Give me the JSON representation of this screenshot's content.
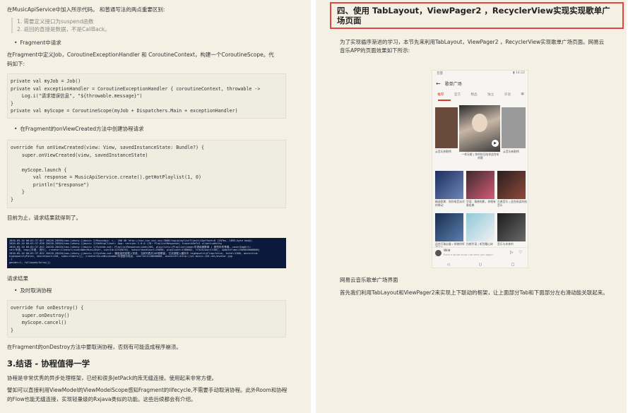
{
  "left": {
    "intro": "在MusicApiService中加入所示代码。 和普通写法的两点重要区别:",
    "quote1": "1. 需要定义接口为suspend函数",
    "quote2": "2. 返回的直接是数据，不是CallBack。",
    "bullet1": "Fragment中请求",
    "desc1a": "在Fragment中定义Job，CoroutineExceptionHandler 和 CoroutineContext，构建一个CoroutineScope。代",
    "desc1b": "码如下:",
    "code1": "private val myJob = Job()\nprivate val exceptionHandler = CoroutineExceptionHandler { coroutineContext, throwable ->\n    Log.i(\"请求错误信息\", \"${throwable.message}\")\n}\nprivate val myScope = CoroutineScope(myJob + Dispatchers.Main + exceptionHandler)",
    "bullet2": "在Fragment的onViewCreated方法中创建协程请求",
    "code2": "override fun onViewCreated(view: View, savedInstanceState: Bundle?) {\n    super.onViewCreated(view, savedInstanceState)\n\n    myScope.launch {\n        val response = MusicApiService.create().getHotPlaylist(1, 0)\n        println(\"$response\")\n    }\n}",
    "result_text": "目前为止，请求结果就得到了。",
    "log_lines": [
      "2020-05-10 00:01:37.827 20420-20590/com.johnny.jjmusic I/MusicApi: <-- 200 OK http://xxx.xxx.xxx.xxx:3000/top/playlist?limit=1&offset=0 (207ms, 2093-byte body)",
      "2020-05-10 00:01:37.838 20420-20504/com.johnny.jjmusic I/OkHttpClient: App: version 1.0.0 (ID: PlaylistResponse) trace=b3e7c2 client=okhttp",
      "2020-05-10 00:01:37.842 20420-20420/com.johnny.jjmusic I/System.out: PlaylistResponse(code=200, playlists=[Playlist(name=华语经典歌单 | 那些年的青春, coverImgUrl=",
      "  cat=华语, tag=[华语, 流行], creator=Creator(nickname=MusicUser, userId=12345678), subscribedCount=25890, playCount=1380002, trackCount=100), updateTime=1589040000000)",
      "2020-05-10 00:01:37.852 20420-20420/com.johnny.jjmusic I/System.out: 播放量信息载入完成, 当前列表共100首歌曲, 已全部载入缓存中 highqualityFlag=false, total=1300, more=true",
      "  highqualityFalse, shareCount=150, subscribers=[], creatorVoiceNickname=华语音乐电台, userId=2110000000, avatarUrl=http://p1.music.126.net/avatar.jpg",
      "  ,]",
      "  gender=1, followed=false)])"
    ],
    "req_result": "请求结果",
    "bullet3": "及时取消协程",
    "code3": "override fun onDestroy() {\n    super.onDestroy()\n    myScope.cancel()\n}",
    "cancel_text": "在Fragment的onDestroy方法中要取消协程，否则有可能造成程序崩溃。",
    "heading": "3.结语 - 协程值得一学",
    "concl1": "协程是非常优秀的异步处理框架，已经和很多JetPack的库无缝连接。使用起来非常方便。",
    "concl2a": "譬如可以直接利用ViewModel的ViewModelScope感知Fragment的lifecycle,不需要手动取消协程。此外Room和协程",
    "concl2b": "的Flow也能无缝连接，实现轻量级的Rxjava类似的功能。这些后续都会有介绍。"
  },
  "right": {
    "title": "四、使用 TabLayout，ViewPager2 ，RecyclerView实现实现歌单广场页面",
    "intro1": "为了实现循序渐进的学习，本节先来利用TabLayout，ViewPager2 ，RecyclerView实现歌单广场页面。网易云",
    "intro2": "音乐APP的页面效果如下所示:",
    "caption": "网易云音乐歌单广场界面",
    "desc": "首先我们利用TabLayout和ViewPager2来实现上下联动的框架，让上面部分Tab和下面部分左右滑动能关联起来。",
    "phone": {
      "status_left": "音量",
      "status_right": "▮ 14:22",
      "header_title": "歌单广场",
      "tabs": [
        "推荐",
        "官方",
        "精品",
        "独立",
        "华语"
      ],
      "cards": [
        "云音乐热歌榜",
        "一样无眠 | 你的秋日陪伴适合听的歌",
        "云音乐新歌榜",
        "精选欧美：和你电音派对的律动",
        "华语：情感电影，伴唱有歌经典",
        "古典音乐 | 适合阅读的纯音乐",
        "适合打球必备 / 伴随你挥洒汗水",
        "伤感华语 | 听到最心碎",
        "音乐与未来的"
      ],
      "player_name": "Wild",
      "player_sub": "Even a white snow I've seen you again"
    }
  },
  "colors": {
    "page_bg": "#f4f1e4",
    "title_border": "#e34545",
    "accent_red": "#d9382d",
    "log_bg": "#0b1a3a"
  }
}
